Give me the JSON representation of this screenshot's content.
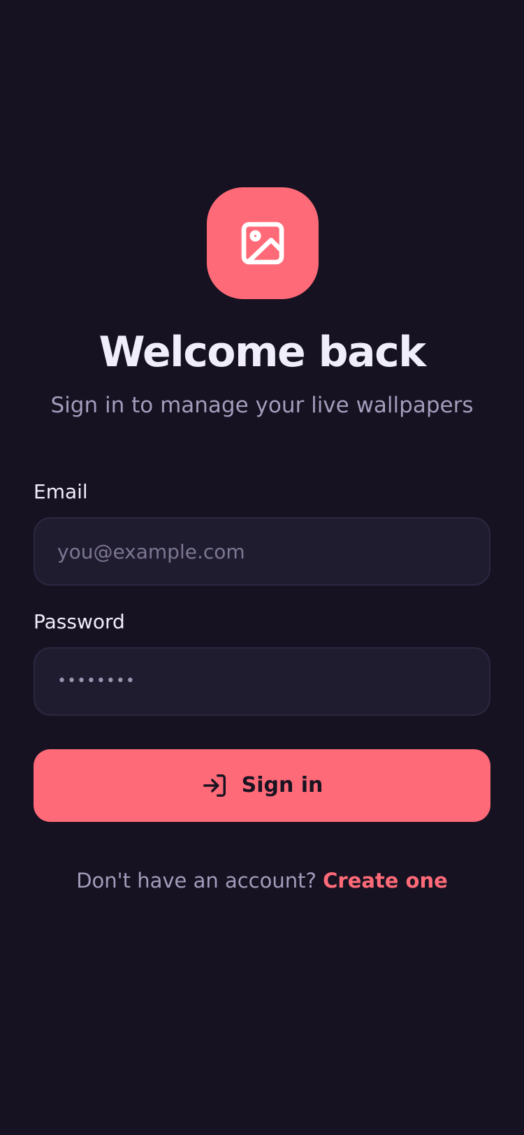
{
  "colors": {
    "background": "#161221",
    "accent": "#ff6a78",
    "input_background": "#201c30",
    "text_primary": "#f1eefb",
    "text_secondary": "#a39cbb"
  },
  "logo": {
    "icon": "image-icon"
  },
  "header": {
    "title": "Welcome back",
    "subtitle": "Sign in to manage your live wallpapers"
  },
  "form": {
    "email": {
      "label": "Email",
      "placeholder": "you@example.com",
      "value": ""
    },
    "password": {
      "label": "Password",
      "masked_value": "••••••••"
    },
    "submit": {
      "label": "Sign in",
      "icon": "login-icon"
    }
  },
  "footer": {
    "prompt": "Don't have an account?",
    "link": "Create one"
  }
}
